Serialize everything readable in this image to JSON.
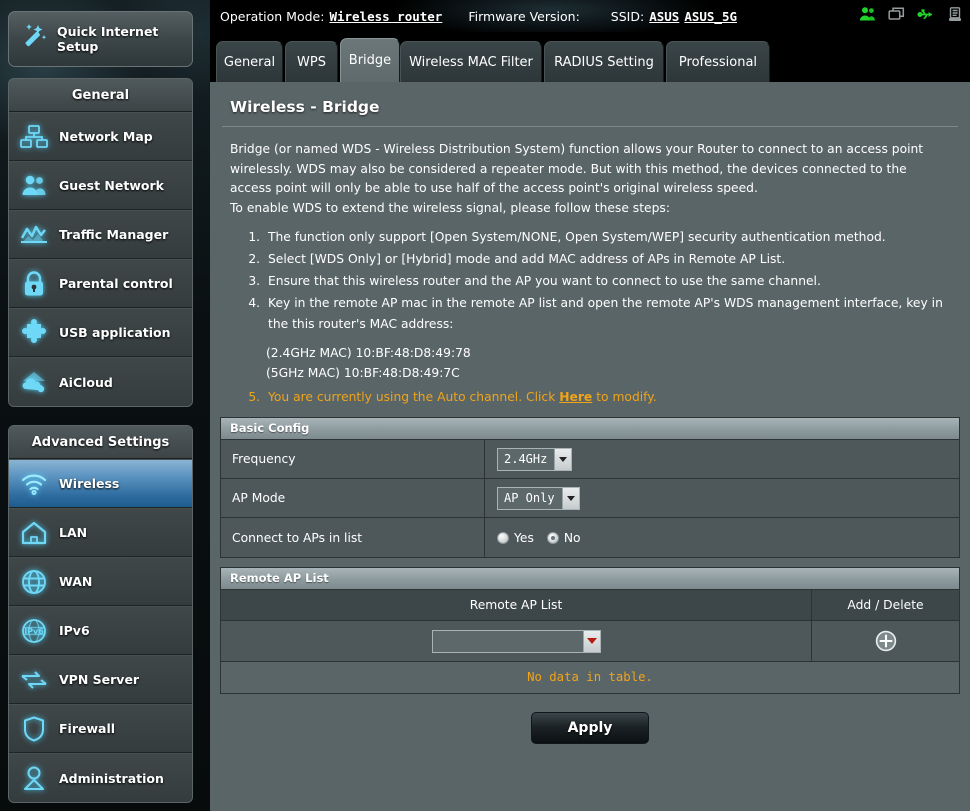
{
  "sidebar": {
    "quick_setup": {
      "label": "Quick Internet Setup",
      "icon": "magic-wand-icon"
    },
    "general": {
      "title": "General",
      "items": [
        {
          "label": "Network Map",
          "icon": "network-map-icon"
        },
        {
          "label": "Guest Network",
          "icon": "users-icon"
        },
        {
          "label": "Traffic Manager",
          "icon": "chart-icon"
        },
        {
          "label": "Parental control",
          "icon": "lock-icon"
        },
        {
          "label": "USB application",
          "icon": "puzzle-icon"
        },
        {
          "label": "AiCloud",
          "icon": "cloud-icon"
        }
      ]
    },
    "advanced": {
      "title": "Advanced Settings",
      "items": [
        {
          "label": "Wireless",
          "icon": "wifi-icon",
          "active": true
        },
        {
          "label": "LAN",
          "icon": "home-icon",
          "active": false
        },
        {
          "label": "WAN",
          "icon": "globe-icon",
          "active": false
        },
        {
          "label": "IPv6",
          "icon": "ipv6-icon",
          "active": false
        },
        {
          "label": "VPN Server",
          "icon": "vpn-icon",
          "active": false
        },
        {
          "label": "Firewall",
          "icon": "shield-icon",
          "active": false
        },
        {
          "label": "Administration",
          "icon": "person-icon",
          "active": false
        }
      ]
    }
  },
  "topbar": {
    "operation_mode_label": "Operation Mode:",
    "operation_mode_value": "Wireless router",
    "firmware_label": "Firmware Version:",
    "firmware_value": "",
    "ssid_label": "SSID:",
    "ssid_1": "ASUS",
    "ssid_2": "ASUS_5G",
    "icons": [
      "clients-icon",
      "display-icon",
      "usb-icon",
      "printer-icon"
    ]
  },
  "tabs": [
    {
      "label": "General",
      "active": false
    },
    {
      "label": "WPS",
      "active": false
    },
    {
      "label": "Bridge",
      "active": true
    },
    {
      "label": "Wireless MAC Filter",
      "active": false
    },
    {
      "label": "RADIUS Setting",
      "active": false
    },
    {
      "label": "Professional",
      "active": false
    }
  ],
  "page": {
    "title": "Wireless - Bridge",
    "intro_1": "Bridge (or named WDS - Wireless Distribution System) function allows your Router to connect to an access point wirelessly. WDS may also be considered a repeater mode. But with this method, the devices connected to the access point will only be able to use half of the access point's original wireless speed.",
    "intro_2": "To enable WDS to extend the wireless signal, please follow these steps:",
    "steps": [
      "The function only support [Open System/NONE, Open System/WEP] security authentication method.",
      "Select [WDS Only] or [Hybrid] mode and add MAC address of APs in Remote AP List.",
      "Ensure that this wireless router and the AP you want to connect to use the same channel.",
      "Key in the remote AP mac in the remote AP list and open the remote AP's WDS management interface, key in the this router's MAC address:"
    ],
    "mac_24": "(2.4GHz MAC) 10:BF:48:D8:49:78",
    "mac_5": "(5GHz MAC) 10:BF:48:D8:49:7C",
    "step5_pre": "You are currently using the Auto channel. Click ",
    "step5_link": "Here",
    "step5_post": " to modify.",
    "warn_color": "#f0a419"
  },
  "basic_config": {
    "title": "Basic Config",
    "frequency": {
      "label": "Frequency",
      "value": "2.4GHz"
    },
    "ap_mode": {
      "label": "AP Mode",
      "value": "AP Only"
    },
    "connect": {
      "label": "Connect to APs in list",
      "yes_label": "Yes",
      "no_label": "No",
      "selected": "No"
    }
  },
  "remote_ap": {
    "title": "Remote AP List",
    "col_list": "Remote AP List",
    "col_action": "Add / Delete",
    "input_value": "",
    "add_icon": "plus-circle-icon",
    "empty_text": "No data in table."
  },
  "apply": {
    "label": "Apply"
  }
}
